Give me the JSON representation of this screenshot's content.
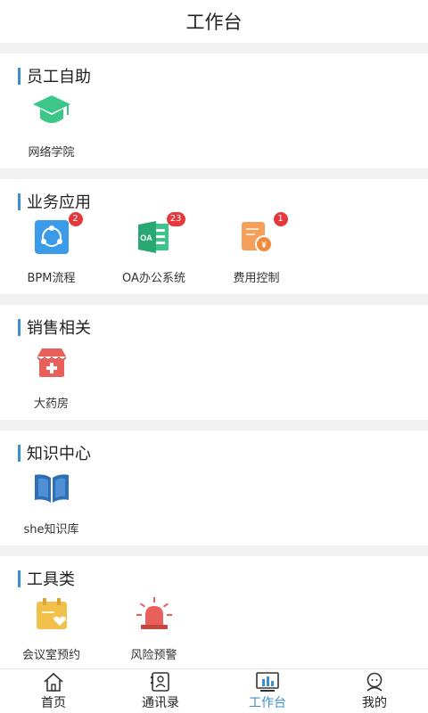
{
  "header": {
    "title": "工作台"
  },
  "sections": [
    {
      "title": "员工自助",
      "items": [
        {
          "label": "网络学院",
          "icon": "graduation-cap-icon"
        }
      ]
    },
    {
      "title": "业务应用",
      "items": [
        {
          "label": "BPM流程",
          "icon": "bpm-flow-icon",
          "badge": "2"
        },
        {
          "label": "OA办公系统",
          "icon": "oa-office-icon",
          "badge": "23"
        },
        {
          "label": "费用控制",
          "icon": "expense-receipt-icon",
          "badge": "1"
        }
      ]
    },
    {
      "title": "销售相关",
      "items": [
        {
          "label": "大药房",
          "icon": "pharmacy-store-icon"
        }
      ]
    },
    {
      "title": "知识中心",
      "items": [
        {
          "label": "she知识库",
          "icon": "open-book-icon"
        }
      ]
    },
    {
      "title": "工具类",
      "items": [
        {
          "label": "会议室预约",
          "icon": "calendar-heart-icon"
        },
        {
          "label": "风险预警",
          "icon": "alarm-siren-icon"
        }
      ]
    }
  ],
  "tabbar": [
    {
      "label": "首页",
      "icon": "home-icon"
    },
    {
      "label": "通讯录",
      "icon": "contacts-icon"
    },
    {
      "label": "工作台",
      "icon": "workbench-icon",
      "active": true
    },
    {
      "label": "我的",
      "icon": "profile-icon"
    }
  ],
  "colors": {
    "accent": "#3b8ed0",
    "badge": "#e4393c",
    "green": "#3cc68a",
    "orange": "#f5a05a",
    "red": "#e8605a",
    "yellow": "#f2c14b",
    "blue": "#2f6fb6"
  }
}
